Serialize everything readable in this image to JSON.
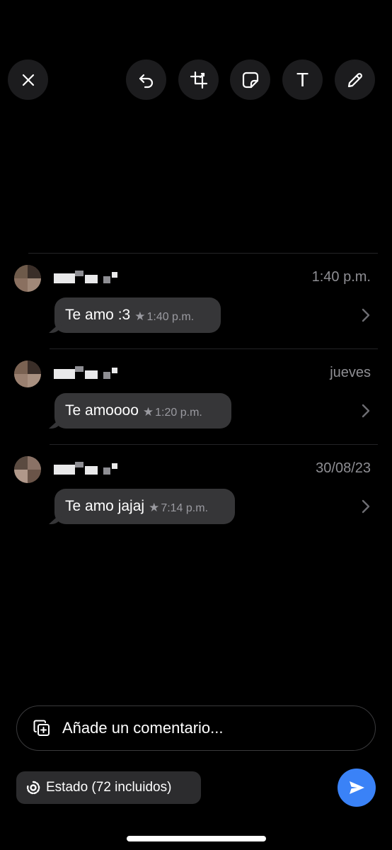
{
  "toolbar": {
    "buttons": [
      {
        "name": "close-button",
        "icon": "close-icon"
      },
      {
        "name": "undo-button",
        "icon": "undo-icon"
      },
      {
        "name": "crop-button",
        "icon": "crop-icon"
      },
      {
        "name": "sticker-button",
        "icon": "sticker-icon"
      },
      {
        "name": "text-button",
        "icon": "text-icon",
        "glyph": "T"
      },
      {
        "name": "draw-button",
        "icon": "pencil-icon"
      }
    ]
  },
  "messages": [
    {
      "date": "1:40 p.m.",
      "text": "Te amo :3",
      "star": "★",
      "time": "1:40 p.m."
    },
    {
      "date": "jueves",
      "text": "Te amoooo",
      "star": "★",
      "time": "1:20 p.m."
    },
    {
      "date": "30/08/23",
      "text": "Te amo jajaj",
      "star": "★",
      "time": "7:14 p.m."
    }
  ],
  "composer": {
    "placeholder": "Añade un comentario...",
    "status_label": "Estado (72 incluidos)",
    "send_icon": "send-icon"
  },
  "colors": {
    "background": "#000000",
    "bubble": "#363638",
    "accent": "#3a82f7",
    "muted_text": "#8e8e93"
  }
}
